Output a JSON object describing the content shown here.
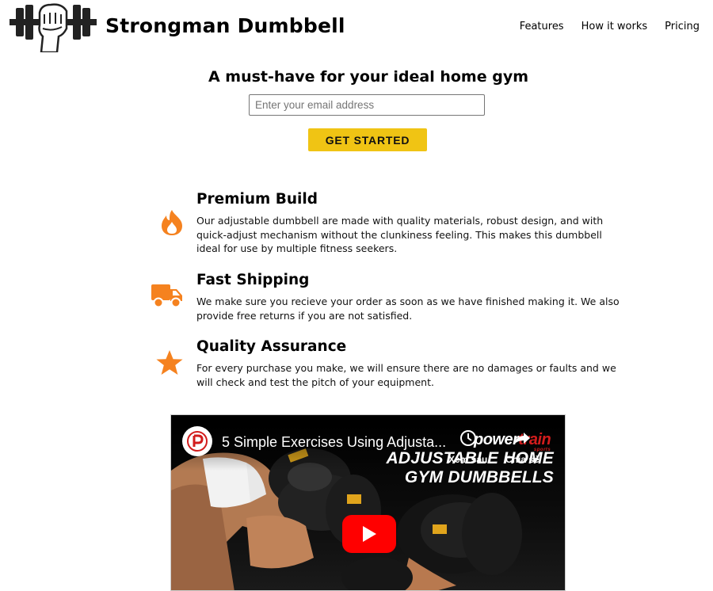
{
  "header": {
    "brand": "Strongman Dumbbell",
    "nav": [
      "Features",
      "How it works",
      "Pricing"
    ]
  },
  "hero": {
    "title": "A must-have for your ideal home gym",
    "email_placeholder": "Enter your email address",
    "cta_label": "GET STARTED"
  },
  "features": [
    {
      "icon": "fire-icon",
      "title": "Premium Build",
      "text": "Our adjustable dumbbell are made with quality materials, robust design, and with quick-adjust mechanism without the clunkiness feeling. This makes this dumbbell ideal for use by multiple fitness seekers."
    },
    {
      "icon": "truck-icon",
      "title": "Fast Shipping",
      "text": "We make sure you recieve your order as soon as we have finished making it. We also provide free returns if you are not satisfied."
    },
    {
      "icon": "star-icon",
      "title": "Quality Assurance",
      "text": "For every purchase you make, we will ensure there are no damages or faults and we will check and test the pitch of your equipment."
    }
  ],
  "video": {
    "title": "5 Simple Exercises Using Adjusta...",
    "watch_later": "Xem sau",
    "share": "Chia sẻ",
    "brand_logo_a": "power",
    "brand_logo_b": "train",
    "brand_logo_sub": "sports",
    "headline_line1": "ADJUSTABLE HOME",
    "headline_line2": "GYM DUMBBELLS"
  },
  "colors": {
    "accent_icon": "#f5821f",
    "cta_bg": "#f0c414",
    "play_red": "#ff0000"
  }
}
